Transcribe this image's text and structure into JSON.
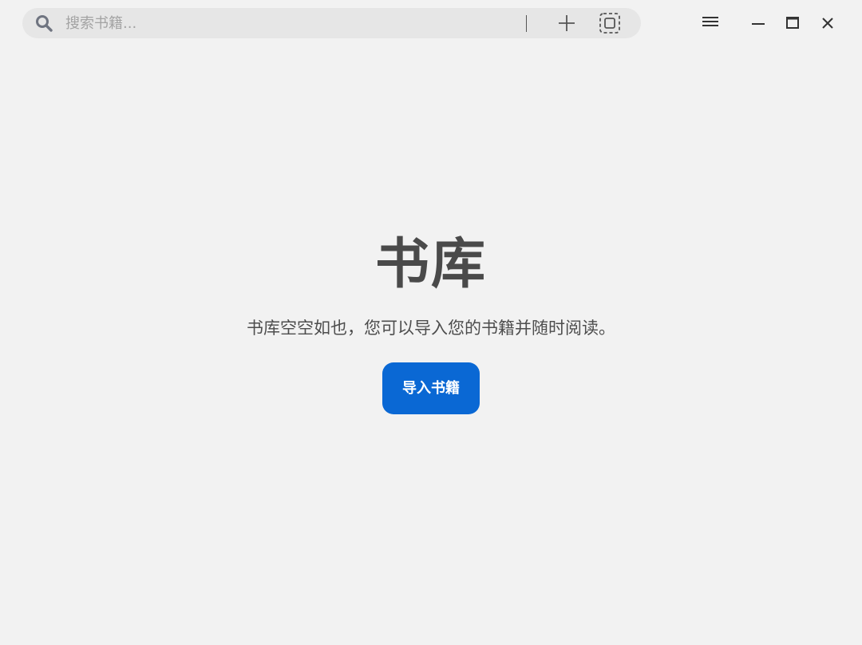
{
  "search": {
    "placeholder": "搜索书籍...",
    "icon": "search-icon"
  },
  "toolbar": {
    "add_icon": "plus-icon",
    "fullscreen_icon": "fullscreen-icon"
  },
  "window_controls": {
    "menu_icon": "hamburger-menu-icon",
    "minimize_icon": "minimize-icon",
    "maximize_icon": "maximize-icon",
    "close_icon": "close-icon"
  },
  "library": {
    "title": "书库",
    "empty_message": "书库空空如也，您可以导入您的书籍并随时阅读。",
    "import_button_label": "导入书籍"
  },
  "colors": {
    "background": "#f2f2f2",
    "search_bar": "#e6e6e6",
    "accent": "#0a68d4",
    "title_text": "#4a4a4a"
  }
}
